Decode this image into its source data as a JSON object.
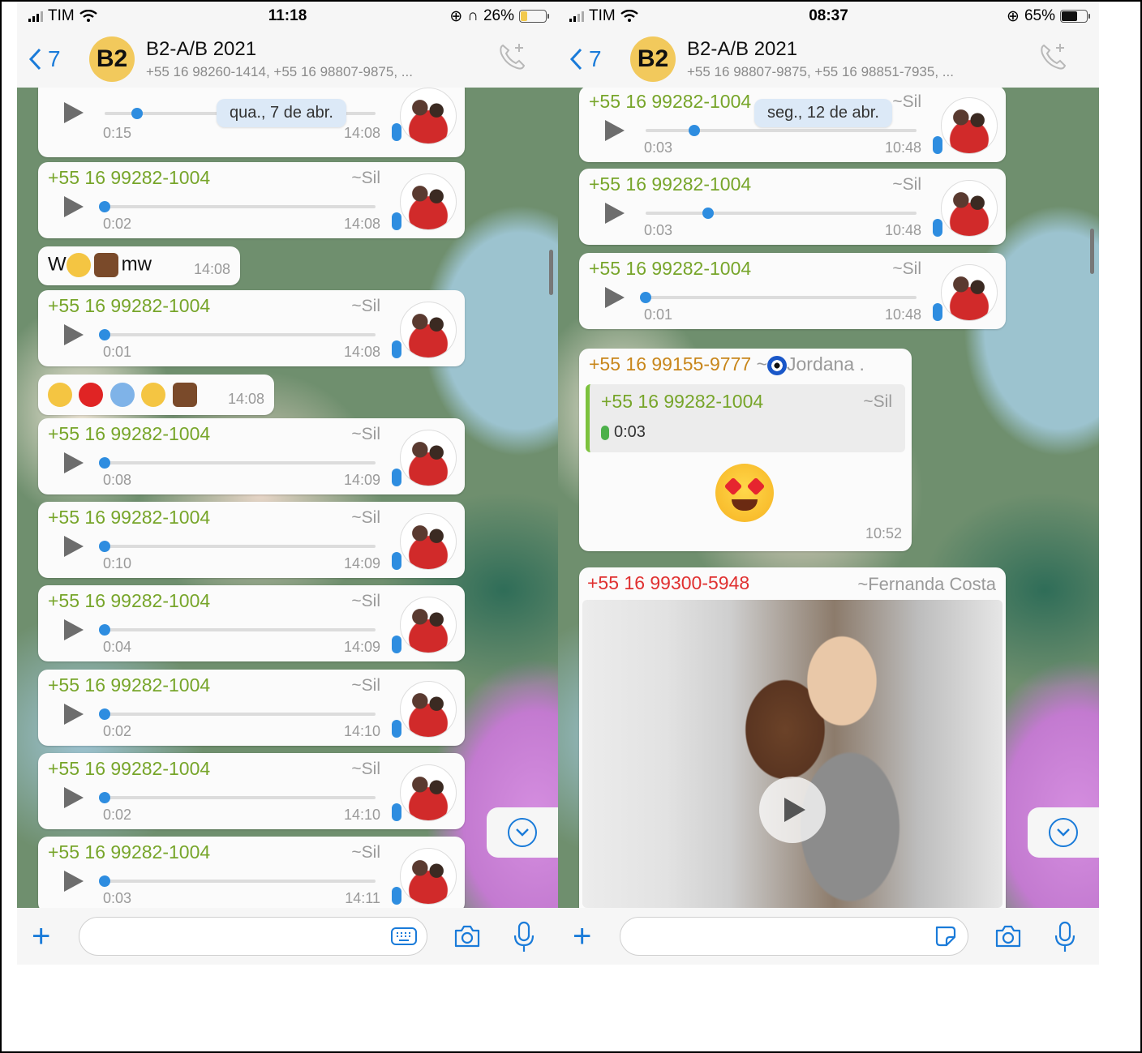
{
  "left": {
    "status": {
      "carrier": "TIM",
      "time": "11:18",
      "battery": "26%",
      "battery_fill": 0.26,
      "battery_color": "#f2c94c"
    },
    "header": {
      "back_count": "7",
      "avatar": "B2",
      "title": "B2-A/B 2021",
      "subtitle": "+55 16 98260-1414, +55 16 98807-9875, ..."
    },
    "date_pill": "qua., 7 de abr.",
    "first_voice": {
      "duration": "0:15",
      "time": "14:08",
      "progress": 0.12
    },
    "text1": {
      "text_a": "W",
      "text_b": "mw",
      "time": "14:08"
    },
    "emoji_msg": {
      "time": "14:08"
    },
    "voices": [
      {
        "sender": "+55 16 99282-1004",
        "alias": "~Sil",
        "duration": "0:02",
        "time": "14:08",
        "progress": 0
      },
      {
        "sender": "+55 16 99282-1004",
        "alias": "~Sil",
        "duration": "0:01",
        "time": "14:08",
        "progress": 0
      },
      {
        "sender": "+55 16 99282-1004",
        "alias": "~Sil",
        "duration": "0:08",
        "time": "14:09",
        "progress": 0
      },
      {
        "sender": "+55 16 99282-1004",
        "alias": "~Sil",
        "duration": "0:10",
        "time": "14:09",
        "progress": 0
      },
      {
        "sender": "+55 16 99282-1004",
        "alias": "~Sil",
        "duration": "0:04",
        "time": "14:09",
        "progress": 0
      },
      {
        "sender": "+55 16 99282-1004",
        "alias": "~Sil",
        "duration": "0:02",
        "time": "14:10",
        "progress": 0
      },
      {
        "sender": "+55 16 99282-1004",
        "alias": "~Sil",
        "duration": "0:02",
        "time": "14:10",
        "progress": 0
      },
      {
        "sender": "+55 16 99282-1004",
        "alias": "~Sil",
        "duration": "0:03",
        "time": "14:11",
        "progress": 0
      }
    ]
  },
  "right": {
    "status": {
      "carrier": "TIM",
      "time": "08:37",
      "battery": "65%",
      "battery_fill": 0.65,
      "battery_color": "#111111"
    },
    "header": {
      "back_count": "7",
      "avatar": "B2",
      "title": "B2-A/B 2021",
      "subtitle": "+55 16 98807-9875, +55 16 98851-7935, ..."
    },
    "date_pill": "seg., 12 de abr.",
    "voices": [
      {
        "sender": "+55 16 99282-1004",
        "alias": "~Sil",
        "duration": "0:03",
        "time": "10:48",
        "progress": 0.18
      },
      {
        "sender": "+55 16 99282-1004",
        "alias": "~Sil",
        "duration": "0:03",
        "time": "10:48",
        "progress": 0.23
      },
      {
        "sender": "+55 16 99282-1004",
        "alias": "~Sil",
        "duration": "0:01",
        "time": "10:48",
        "progress": 0
      }
    ],
    "reply": {
      "sender": "+55 16 99155-9777",
      "alias_prefix": "~",
      "alias": "Jordana .",
      "quoted_sender": "+55 16 99282-1004",
      "quoted_alias": "~Sil",
      "quoted_duration": "0:03",
      "time": "10:52"
    },
    "video": {
      "sender": "+55 16 99300-5948",
      "alias": "~Fernanda Costa"
    }
  },
  "icons": {
    "back": "chevron-left-icon",
    "call": "add-call-icon",
    "play": "play-icon",
    "mic": "microphone-icon",
    "plus": "plus-icon",
    "camera": "camera-icon",
    "keyboard": "keyboard-icon",
    "sticker": "sticker-icon",
    "scroll_down": "chevron-down-icon"
  },
  "colors": {
    "sender_green": "#77a52a",
    "sender_orange": "#c8861b",
    "sender_red": "#e03030",
    "accent_blue": "#1a7bd9"
  }
}
